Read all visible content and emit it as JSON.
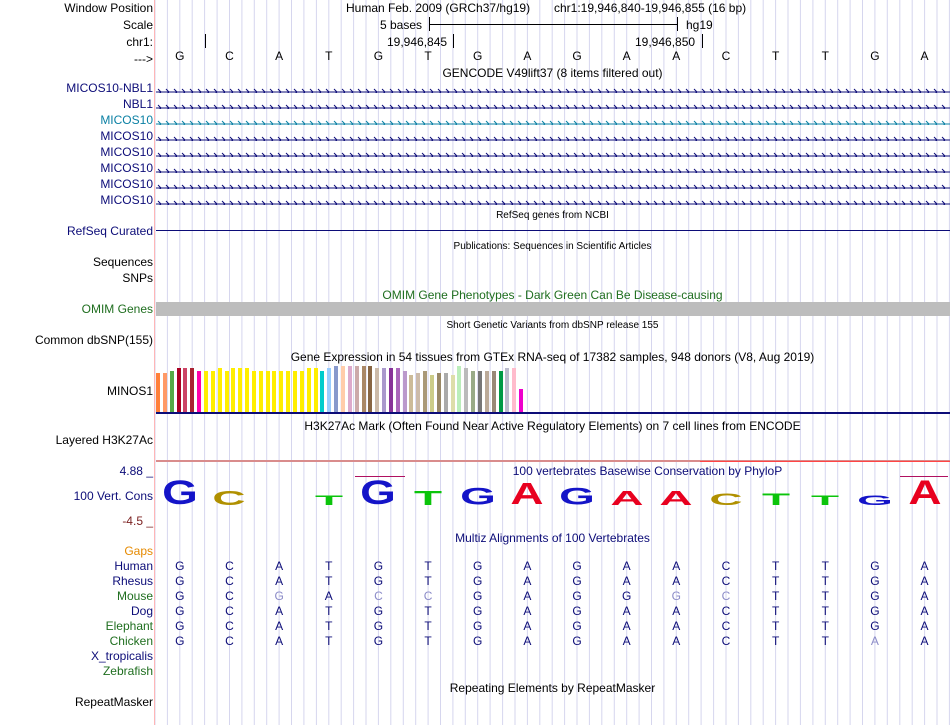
{
  "header": {
    "window_label": "Window Position",
    "scale_label": "Scale",
    "chr_label": "chr1:",
    "arrow_label": "--->",
    "assembly": "Human Feb. 2009 (GRCh37/hg19)",
    "range": "chr1:19,946,840-19,946,855 (16 bp)",
    "scale_text": "5 bases",
    "scale_db": "hg19",
    "pos1": "19,946,845",
    "pos2": "19,946,850"
  },
  "sequence": [
    "G",
    "C",
    "A",
    "T",
    "G",
    "T",
    "G",
    "A",
    "G",
    "A",
    "A",
    "C",
    "T",
    "T",
    "G",
    "A"
  ],
  "gencode": {
    "title": "GENCODE V49lift37 (8 items filtered out)",
    "rows": [
      {
        "label": "MICOS10-NBL1",
        "color": "#0c0c78"
      },
      {
        "label": "NBL1",
        "color": "#0c0c78"
      },
      {
        "label": "MICOS10",
        "color": "#0b80a4"
      },
      {
        "label": "MICOS10",
        "color": "#0c0c78"
      },
      {
        "label": "MICOS10",
        "color": "#0c0c78"
      },
      {
        "label": "MICOS10",
        "color": "#0c0c78"
      },
      {
        "label": "MICOS10",
        "color": "#0c0c78"
      },
      {
        "label": "MICOS10",
        "color": "#0c0c78"
      }
    ]
  },
  "refseq": {
    "title": "RefSeq genes from NCBI",
    "label": "RefSeq Curated"
  },
  "pubs": {
    "title": "Publications: Sequences in Scientific Articles",
    "label1": "Sequences",
    "label2": "SNPs"
  },
  "omim": {
    "title": "OMIM Gene Phenotypes - Dark Green Can Be Disease-causing",
    "label": "OMIM Genes"
  },
  "dbsnp": {
    "title": "Short Genetic Variants from dbSNP release 155",
    "label": "Common dbSNP(155)"
  },
  "gtex": {
    "title": "Gene Expression in 54 tissues from GTEx RNA-seq of 17382 samples, 948 donors (V8, Aug 2019)",
    "label": "MINOS1",
    "bars": [
      {
        "c": "#ff7f3a",
        "v": 0.85
      },
      {
        "c": "#ff9966",
        "v": 0.85
      },
      {
        "c": "#55aa44",
        "v": 0.9
      },
      {
        "c": "#aa0022",
        "v": 0.95
      },
      {
        "c": "#cc4466",
        "v": 0.95
      },
      {
        "c": "#aa2233",
        "v": 0.95
      },
      {
        "c": "#ff00aa",
        "v": 0.9
      },
      {
        "c": "#ffee00",
        "v": 0.9
      },
      {
        "c": "#ffee00",
        "v": 0.9
      },
      {
        "c": "#ffee00",
        "v": 0.95
      },
      {
        "c": "#ffee00",
        "v": 0.9
      },
      {
        "c": "#ffee00",
        "v": 0.95
      },
      {
        "c": "#ffee00",
        "v": 0.95
      },
      {
        "c": "#ffee00",
        "v": 0.95
      },
      {
        "c": "#ffee00",
        "v": 0.9
      },
      {
        "c": "#ffee00",
        "v": 0.9
      },
      {
        "c": "#ffee00",
        "v": 0.9
      },
      {
        "c": "#ffee00",
        "v": 0.9
      },
      {
        "c": "#ffee00",
        "v": 0.9
      },
      {
        "c": "#ffee00",
        "v": 0.9
      },
      {
        "c": "#ffee00",
        "v": 0.9
      },
      {
        "c": "#ffee00",
        "v": 0.9
      },
      {
        "c": "#ffee00",
        "v": 0.95
      },
      {
        "c": "#ffee00",
        "v": 0.95
      },
      {
        "c": "#00cccc",
        "v": 0.9
      },
      {
        "c": "#99ccff",
        "v": 0.95
      },
      {
        "c": "#8899cc",
        "v": 1.0
      },
      {
        "c": "#ffccaa",
        "v": 1.0
      },
      {
        "c": "#ddaacc",
        "v": 1.0
      },
      {
        "c": "#ccaaaa",
        "v": 1.0
      },
      {
        "c": "#aa8866",
        "v": 1.0
      },
      {
        "c": "#886644",
        "v": 1.0
      },
      {
        "c": "#ccbbaa",
        "v": 0.95
      },
      {
        "c": "#aa99cc",
        "v": 0.95
      },
      {
        "c": "#883399",
        "v": 0.95
      },
      {
        "c": "#aa66bb",
        "v": 0.95
      },
      {
        "c": "#bb99cc",
        "v": 0.9
      },
      {
        "c": "#ccbb99",
        "v": 0.8
      },
      {
        "c": "#ccbbaa",
        "v": 0.85
      },
      {
        "c": "#aa9977",
        "v": 0.9
      },
      {
        "c": "#cccc88",
        "v": 0.8
      },
      {
        "c": "#998866",
        "v": 0.85
      },
      {
        "c": "#aaaaaa",
        "v": 0.85
      },
      {
        "c": "#ddddaa",
        "v": 0.8
      },
      {
        "c": "#bbeebb",
        "v": 1.0
      },
      {
        "c": "#bbbbbb",
        "v": 0.95
      },
      {
        "c": "#99aa88",
        "v": 0.9
      },
      {
        "c": "#777777",
        "v": 0.9
      },
      {
        "c": "#bbaa99",
        "v": 0.9
      },
      {
        "c": "#998877",
        "v": 0.9
      },
      {
        "c": "#009944",
        "v": 0.9
      },
      {
        "c": "#bbbbcc",
        "v": 0.95
      },
      {
        "c": "#ffbbcc",
        "v": 0.95
      },
      {
        "c": "#ee00cc",
        "v": 0.5
      }
    ]
  },
  "h3k27": {
    "title": "H3K27Ac Mark (Often Found Near Active Regulatory Elements) on 7 cell lines from ENCODE",
    "label": "Layered H3K27Ac"
  },
  "cons": {
    "title": "100 vertebrates Basewise Conservation by PhyloP",
    "label": "100 Vert. Cons",
    "max": "4.88 _",
    "min": "-4.5 _",
    "logo": [
      {
        "b": "G",
        "s": 1.0
      },
      {
        "b": "C",
        "s": 0.6
      },
      {
        "b": "A",
        "s": 0.0
      },
      {
        "b": "T",
        "s": 0.4
      },
      {
        "b": "G",
        "s": 1.0
      },
      {
        "b": "T",
        "s": 0.6
      },
      {
        "b": "G",
        "s": 0.7
      },
      {
        "b": "A",
        "s": 0.9
      },
      {
        "b": "G",
        "s": 0.7
      },
      {
        "b": "A",
        "s": 0.6
      },
      {
        "b": "A",
        "s": 0.6
      },
      {
        "b": "C",
        "s": 0.5
      },
      {
        "b": "T",
        "s": 0.5
      },
      {
        "b": "T",
        "s": 0.4
      },
      {
        "b": "G",
        "s": 0.4
      },
      {
        "b": "A",
        "s": 1.0
      }
    ]
  },
  "multiz": {
    "title": "Multiz Alignments of 100 Vertebrates",
    "gaps": "Gaps",
    "species": [
      {
        "name": "Human",
        "color": "#0c0c78",
        "seq": "GCATGTGAGAACTTGA",
        "faint": ""
      },
      {
        "name": "Rhesus",
        "color": "#0c0c78",
        "seq": "GCATGTGAGAACTTGA",
        "faint": ""
      },
      {
        "name": "Mouse",
        "color": "#1f6e1f",
        "seq": "GCGACCGAGGGCTTGA",
        "faint": "0010110000110000"
      },
      {
        "name": "Dog",
        "color": "#0c0c78",
        "seq": "GCATGTGAGAACTTGA",
        "faint": ""
      },
      {
        "name": "Elephant",
        "color": "#1f6e1f",
        "seq": "GCATGTGAGAACTTGA",
        "faint": ""
      },
      {
        "name": "Chicken",
        "color": "#1f6e1f",
        "seq": "GCATGTGAGAACTTAA",
        "faint": "0000000000000010"
      },
      {
        "name": "X_tropicalis",
        "color": "#0c0c78",
        "seq": "",
        "faint": ""
      },
      {
        "name": "Zebrafish",
        "color": "#1f6e1f",
        "seq": "",
        "faint": ""
      }
    ]
  },
  "repeat": {
    "title": "Repeating Elements by RepeatMasker",
    "label": "RepeatMasker"
  }
}
